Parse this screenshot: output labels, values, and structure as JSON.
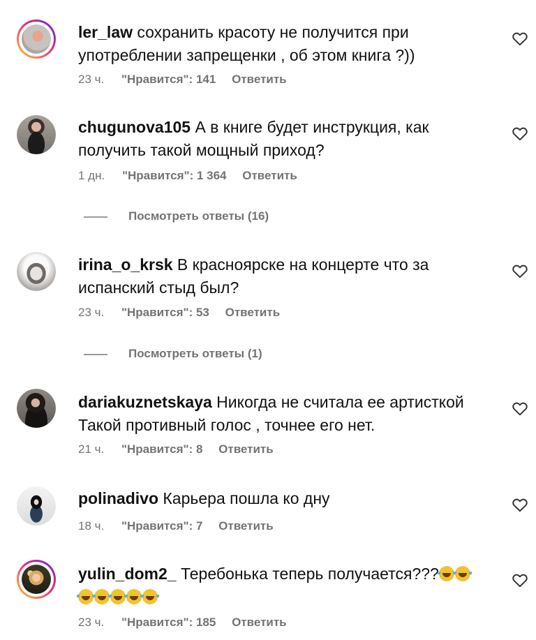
{
  "comments": [
    {
      "username": "ler_law",
      "text": "сохранить красоту не получится при употреблении запрещенки , об этом книга ?))",
      "time": "23 ч.",
      "likes": "\"Нравится\": 141",
      "reply": "Ответить"
    },
    {
      "username": "chugunova105",
      "text": "А в книге будет инструкция, как получить такой мощный приход?",
      "time": "1 дн.",
      "likes": "\"Нравится\": 1 364",
      "reply": "Ответить",
      "view_replies": "Посмотреть ответы (16)"
    },
    {
      "username": "irina_o_krsk",
      "text": "В красноярске на концерте что за испанский стыд был?",
      "time": "23 ч.",
      "likes": "\"Нравится\": 53",
      "reply": "Ответить",
      "view_replies": "Посмотреть ответы (1)"
    },
    {
      "username": "dariakuznetskaya",
      "text": "Никогда не считала ее артисткой Такой противный голос , точнее его нет.",
      "time": "21 ч.",
      "likes": "\"Нравится\": 8",
      "reply": "Ответить"
    },
    {
      "username": "polinadivo",
      "text": "Карьера пошла ко дну",
      "time": "18 ч.",
      "likes": "\"Нравится\": 7",
      "reply": "Ответить"
    },
    {
      "username": "yulin_dom2_",
      "text": "Теребонька теперь получается???",
      "time": "23 ч.",
      "likes": "\"Нравится\": 185",
      "reply": "Ответить"
    }
  ],
  "icons": {
    "like": "heart-outline-icon",
    "emoji": "face-with-tears-of-joy-emoji"
  },
  "colors": {
    "text": "#111111",
    "meta": "#737373",
    "background": "#ffffff"
  }
}
